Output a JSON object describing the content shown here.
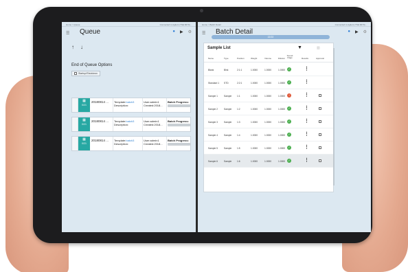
{
  "colors": {
    "accent": "#27a8a3",
    "ok": "#4caf50",
    "error": "#e05a3a",
    "link": "#2d7fd0",
    "screen_bg": "#dce8f1"
  },
  "left": {
    "breadcrumb": "Home > Queue",
    "connection": "Connected to Agilent (TSE:9070)...",
    "title": "Queue",
    "end_of_queue": "End of Queue Options",
    "end_of_queue_option": "Startup/Shutdown",
    "cards": [
      {
        "icon": "calendar-icon",
        "count": "0/21",
        "id": "20180814 ...",
        "template_label": "Template:",
        "template": "batch3",
        "description_label": "Description:",
        "user": "User:admin1",
        "created": "Created:2018...",
        "progress_label": "Batch Progress:"
      },
      {
        "icon": "calendar-icon",
        "count": "0/21",
        "id": "20180814 ...",
        "template_label": "Template:",
        "template": "batch3",
        "description_label": "Description:",
        "user": "User:admin1",
        "created": "Created:2018...",
        "progress_label": "Batch Progress:"
      },
      {
        "icon": "calendar-icon",
        "count": "0/21",
        "id": "20180814 ...",
        "template_label": "Template:",
        "template": "batch3",
        "description_label": "Description:",
        "user": "User:admin1",
        "created": "Created:2018...",
        "progress_label": "Batch Progress:"
      }
    ]
  },
  "right": {
    "breadcrumb": "Home > Batch Detail",
    "connection": "Connected to Agilent (TSE:9070)...",
    "title": "Batch Detail",
    "progress_text": "22/22",
    "progress": 1.0,
    "sample_list_title": "Sample List",
    "headers": [
      "Name",
      "Type",
      "Position",
      "Weight",
      "Volume",
      "Dilution",
      "Sound Flags",
      "Results",
      "Approval"
    ],
    "rows": [
      {
        "name": "Blank",
        "type": "Blnk",
        "position": "2:1:1",
        "weight": "1.0000",
        "volume": "1.0000",
        "dilution": "1.0000",
        "flag": "ok",
        "approval": false,
        "selected": false
      },
      {
        "name": "Standard 1",
        "type": "STD",
        "position": "2:2:1",
        "weight": "1.0000",
        "volume": "1.0000",
        "dilution": "1.0000",
        "flag": "ok",
        "approval": false,
        "selected": false
      },
      {
        "name": "Sample 1",
        "type": "Sample",
        "position": "1:1",
        "weight": "1.0000",
        "volume": "1.0000",
        "dilution": "1.0000",
        "flag": "error",
        "approval": true,
        "selected": false
      },
      {
        "name": "Sample 2",
        "type": "Sample",
        "position": "1:2",
        "weight": "1.0000",
        "volume": "1.0000",
        "dilution": "1.0000",
        "flag": "ok",
        "approval": true,
        "selected": false
      },
      {
        "name": "Sample 3",
        "type": "Sample",
        "position": "1:3",
        "weight": "1.0000",
        "volume": "1.0000",
        "dilution": "1.0000",
        "flag": "ok",
        "approval": true,
        "selected": false
      },
      {
        "name": "Sample 4",
        "type": "Sample",
        "position": "1:4",
        "weight": "1.0000",
        "volume": "1.0000",
        "dilution": "1.0000",
        "flag": "ok",
        "approval": true,
        "selected": false
      },
      {
        "name": "Sample 5",
        "type": "Sample",
        "position": "1:5",
        "weight": "1.0000",
        "volume": "1.0000",
        "dilution": "1.0000",
        "flag": "ok",
        "approval": true,
        "selected": false
      },
      {
        "name": "Sample 6",
        "type": "Sample",
        "position": "1:6",
        "weight": "1.0000",
        "volume": "1.0000",
        "dilution": "1.0000",
        "flag": "ok",
        "approval": true,
        "selected": true
      }
    ]
  }
}
